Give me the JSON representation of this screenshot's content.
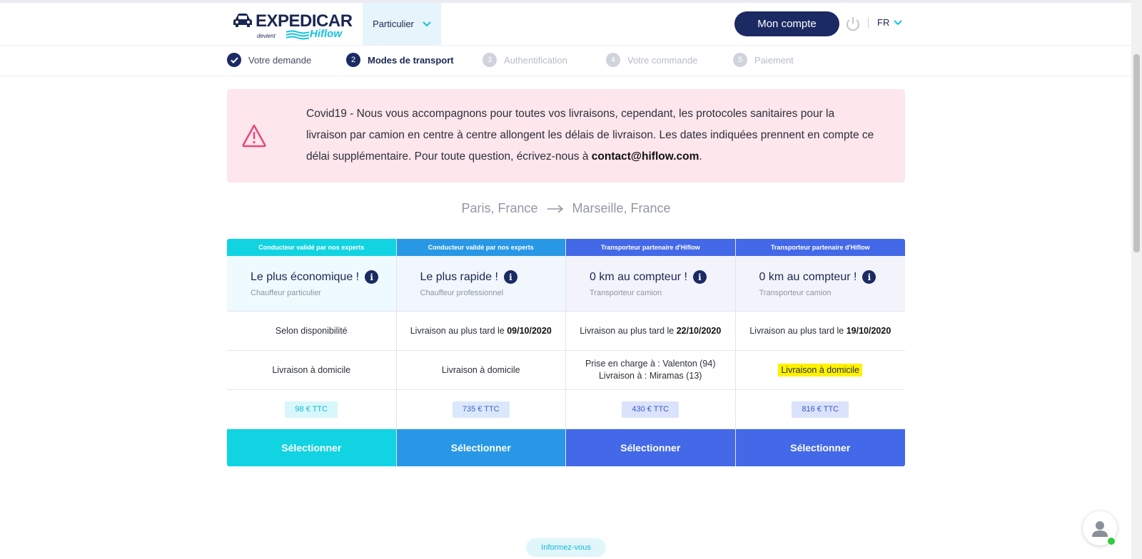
{
  "brand": {
    "name": "EXPEDICAR",
    "tagline_small": "devient",
    "tagline_brand": "Hiflow"
  },
  "header": {
    "segment_label": "Particulier",
    "account_label": "Mon compte",
    "lang_label": "FR"
  },
  "stepper": [
    {
      "num": "",
      "label": "Votre demande",
      "state": "done"
    },
    {
      "num": "2",
      "label": "Modes de transport",
      "state": "active"
    },
    {
      "num": "3",
      "label": "Authentification",
      "state": "todo"
    },
    {
      "num": "4",
      "label": "Votre commande",
      "state": "todo"
    },
    {
      "num": "5",
      "label": "Paiement",
      "state": "todo"
    }
  ],
  "alert": {
    "text": "Covid19 - Nous vous accompagnons pour toutes vos livraisons, cependant, les protocoles sanitaires pour la livraison par camion en centre à centre allongent les délais de livraison. Les dates indiquées prennent en compte ce délai supplémentaire. Pour toute question, écrivez-nous à ",
    "email": "contact@hiflow.com",
    "end": "."
  },
  "route": {
    "from": "Paris, France",
    "arrow": "→",
    "to": "Marseille, France"
  },
  "offers": [
    {
      "top_label": "Conducteur validé par nos experts",
      "title": "Le plus économique !",
      "subtitle": "Chauffeur particulier",
      "delivery_prefix": "Selon disponibilité",
      "delivery_date": "",
      "mode_line1": "Livraison à domicile",
      "mode_line2": "",
      "price": "98 € TTC",
      "button": "Sélectionner",
      "color": "#12d3e2",
      "head_bg": "#eefafd",
      "price_bg": "#d7f7fb",
      "price_color": "#14b8d0"
    },
    {
      "top_label": "Conducteur validé par nos experts",
      "title": "Le plus rapide !",
      "subtitle": "Chauffeur professionnel",
      "delivery_prefix": "Livraison au plus tard le ",
      "delivery_date": "09/10/2020",
      "mode_line1": "Livraison à domicile",
      "mode_line2": "",
      "price": "735 € TTC",
      "button": "Sélectionner",
      "color": "#2898e6",
      "head_bg": "#f1f7fc",
      "price_bg": "#dbe8fb",
      "price_color": "#3c64c9"
    },
    {
      "top_label": "Transporteur partenaire d'Hiflow",
      "title": "0 km au compteur !",
      "subtitle": "Transporteur camion",
      "delivery_prefix": "Livraison au plus tard le ",
      "delivery_date": "22/10/2020",
      "mode_line1": "Prise en charge à : Valenton (94)",
      "mode_line2": "Livraison à : Miramas (13)",
      "price": "430 € TTC",
      "button": "Sélectionner",
      "color": "#4369e8",
      "head_bg": "#f3f4fb",
      "price_bg": "#dbe2fb",
      "price_color": "#3c58c9"
    },
    {
      "top_label": "Transporteur partenaire d'Hiflow",
      "title": "0 km au compteur !",
      "subtitle": "Transporteur camion",
      "delivery_prefix": "Livraison au plus tard le ",
      "delivery_date": "19/10/2020",
      "mode_line1": "Livraison à domicile",
      "mode_line2": "",
      "mode_highlight": true,
      "price": "816 € TTC",
      "button": "Sélectionner",
      "color": "#4369e8",
      "head_bg": "#f3f4fb",
      "price_bg": "#dbe2fb",
      "price_color": "#3c58c9"
    }
  ],
  "footer": {
    "inform_label": "Informez-vous"
  },
  "icons": {
    "alert": "warning-icon",
    "chevron": "chevron-down-icon",
    "power": "power-icon",
    "info": "info-icon",
    "chat": "chat-avatar-icon"
  }
}
